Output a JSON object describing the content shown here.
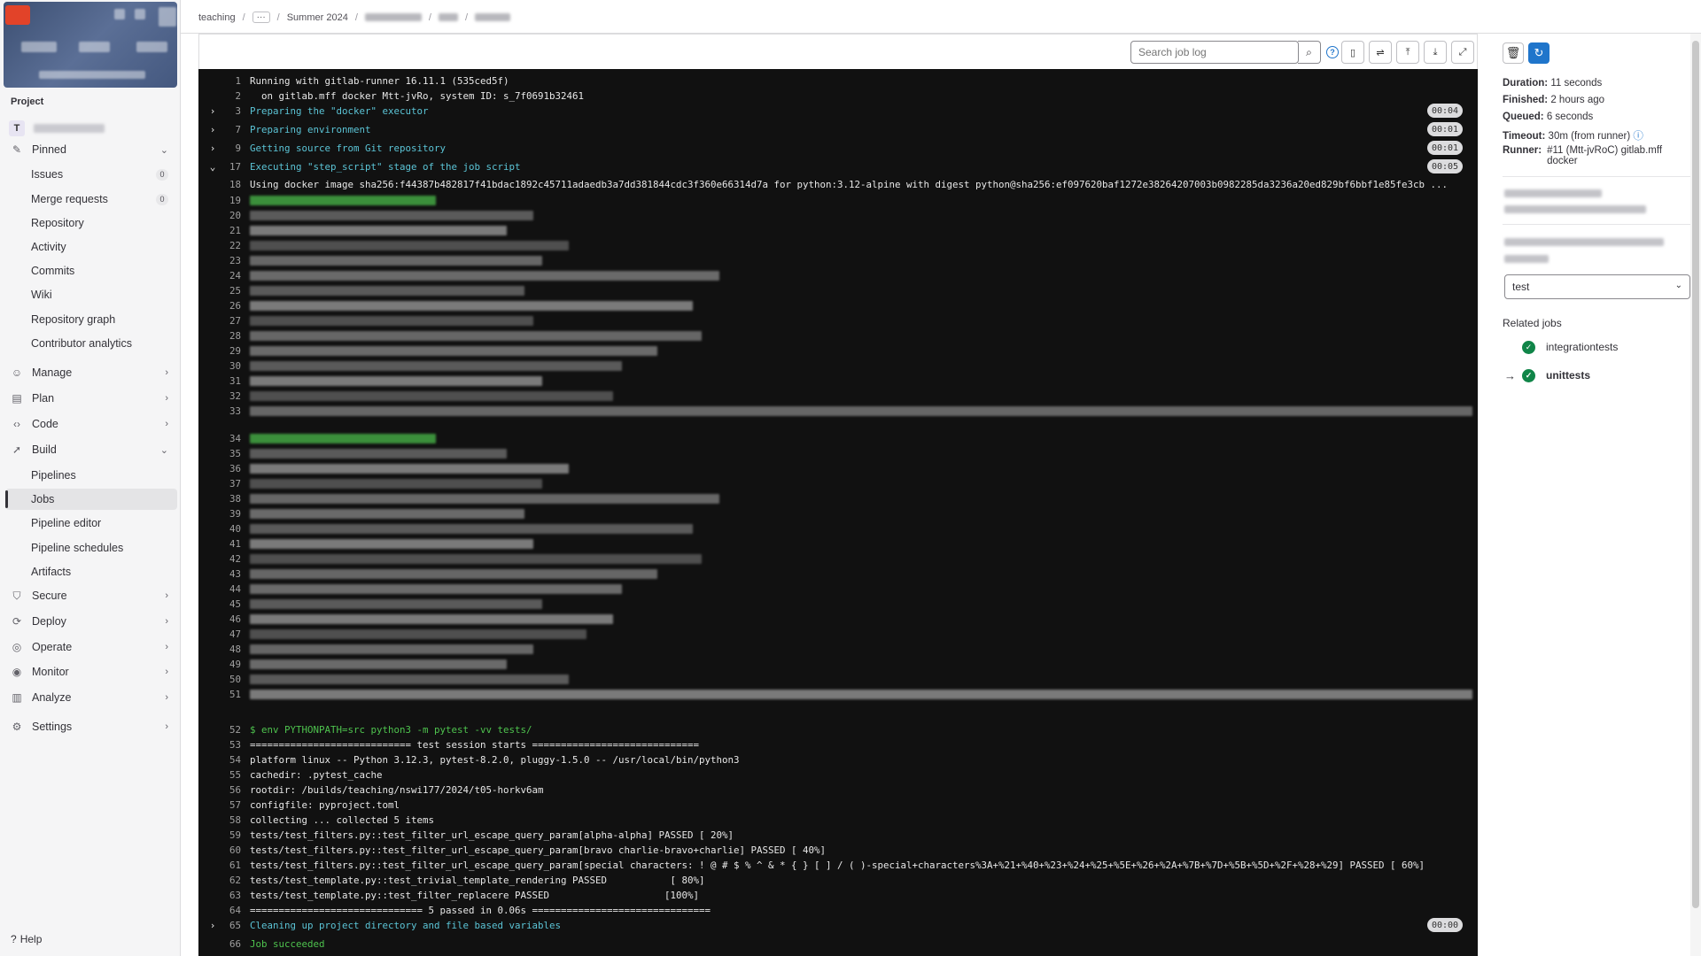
{
  "sidebar": {
    "section_label": "Project",
    "project_avatar_letter": "T",
    "items": [
      {
        "label": "Pinned",
        "icon": "pin-icon",
        "chevron": "˅"
      },
      {
        "label": "Issues",
        "count": "0"
      },
      {
        "label": "Merge requests",
        "count": "0"
      },
      {
        "label": "Repository"
      },
      {
        "label": "Activity"
      },
      {
        "label": "Commits"
      },
      {
        "label": "Wiki"
      },
      {
        "label": "Repository graph"
      },
      {
        "label": "Contributor analytics"
      },
      {
        "label": "Manage",
        "icon": "users-icon"
      },
      {
        "label": "Plan",
        "icon": "plan-icon"
      },
      {
        "label": "Code",
        "icon": "code-icon"
      },
      {
        "label": "Build",
        "icon": "rocket-icon"
      },
      {
        "label": "Pipelines"
      },
      {
        "label": "Jobs"
      },
      {
        "label": "Pipeline editor"
      },
      {
        "label": "Pipeline schedules"
      },
      {
        "label": "Artifacts"
      },
      {
        "label": "Secure",
        "icon": "shield-icon"
      },
      {
        "label": "Deploy",
        "icon": "deploy-icon"
      },
      {
        "label": "Operate",
        "icon": "operate-icon"
      },
      {
        "label": "Monitor",
        "icon": "monitor-icon"
      },
      {
        "label": "Analyze",
        "icon": "chart-icon"
      },
      {
        "label": "Settings",
        "icon": "gear-icon"
      }
    ],
    "help_label": "Help"
  },
  "breadcrumb": {
    "root": "teaching",
    "more": "···",
    "semester": "Summer 2024"
  },
  "log_toolbar": {
    "search_placeholder": "Search job log"
  },
  "log": {
    "lines": [
      {
        "n": "1",
        "text": "Running with gitlab-runner 16.11.1 (535ced5f)"
      },
      {
        "n": "2",
        "text": "  on gitlab.mff docker Mtt-jvRo, system ID: s_7f0691b32461"
      },
      {
        "n": "3",
        "text": "Preparing the \"docker\" executor",
        "time": "00:04"
      },
      {
        "n": "7",
        "text": "Preparing environment",
        "time": "00:01"
      },
      {
        "n": "9",
        "text": "Getting source from Git repository",
        "time": "00:01"
      },
      {
        "n": "17",
        "text": "Executing \"step_script\" stage of the job script",
        "time": "00:05"
      },
      {
        "n": "18",
        "text": "Using docker image sha256:f44387b482817f41bdac1892c45711adaedb3a7dd381844cdc3f360e66314d7a for python:3.12-alpine with digest python@sha256:ef097620baf1272e38264207003b0982285da3236a20ed829bf6bbf1e85fe3cb ..."
      },
      {
        "n": "52",
        "text": "$ env PYTHONPATH=src python3 -m pytest -vv tests/"
      },
      {
        "n": "53",
        "text": "============================ test session starts ============================="
      },
      {
        "n": "54",
        "text": "platform linux -- Python 3.12.3, pytest-8.2.0, pluggy-1.5.0 -- /usr/local/bin/python3"
      },
      {
        "n": "55",
        "text": "cachedir: .pytest_cache"
      },
      {
        "n": "56",
        "text": "rootdir: /builds/teaching/nswi177/2024/t05-horkv6am"
      },
      {
        "n": "57",
        "text": "configfile: pyproject.toml"
      },
      {
        "n": "58",
        "text": "collecting ... collected 5 items"
      },
      {
        "n": "59",
        "text": "tests/test_filters.py::test_filter_url_escape_query_param[alpha-alpha] PASSED [ 20%]"
      },
      {
        "n": "60",
        "text": "tests/test_filters.py::test_filter_url_escape_query_param[bravo charlie-bravo+charlie] PASSED [ 40%]"
      },
      {
        "n": "61",
        "text": "tests/test_filters.py::test_filter_url_escape_query_param[special characters: ! @ # $ % ^ & * { } [ ] / ( )-special+characters%3A+%21+%40+%23+%24+%25+%5E+%26+%2A+%7B+%7D+%5B+%5D+%2F+%28+%29] PASSED [ 60%]"
      },
      {
        "n": "62",
        "text": "tests/test_template.py::test_trivial_template_rendering PASSED           [ 80%]"
      },
      {
        "n": "63",
        "text": "tests/test_template.py::test_filter_replacere PASSED                    [100%]"
      },
      {
        "n": "64",
        "text": "============================== 5 passed in 0.06s ==============================="
      },
      {
        "n": "65",
        "text": "Cleaning up project directory and file based variables",
        "time": "00:00"
      },
      {
        "n": "66",
        "text": "Job succeeded"
      }
    ],
    "hidden_line_numbers": [
      "19",
      "20",
      "21",
      "22",
      "23",
      "24",
      "25",
      "26",
      "27",
      "28",
      "29",
      "30",
      "31",
      "32",
      "33",
      "34",
      "35",
      "36",
      "37",
      "38",
      "39",
      "40",
      "41",
      "42",
      "43",
      "44",
      "45",
      "46",
      "47",
      "48",
      "49",
      "50",
      "51"
    ]
  },
  "job_info": {
    "duration_label": "Duration:",
    "duration": "11 seconds",
    "finished_label": "Finished:",
    "finished": "2 hours ago",
    "queued_label": "Queued:",
    "queued": "6 seconds",
    "timeout_label": "Timeout:",
    "timeout": "30m (from runner)",
    "runner_label": "Runner:",
    "runner": "#11 (Mtt-jvRoC) gitlab.mff docker"
  },
  "stage_select": {
    "value": "test"
  },
  "related_jobs": {
    "title": "Related jobs",
    "jobs": [
      {
        "name": "integrationtests",
        "status": "passed",
        "current": false
      },
      {
        "name": "unittests",
        "status": "passed",
        "current": true
      }
    ],
    "current_marker": "→"
  },
  "colors": {
    "log_bg": "#111111",
    "section_cyan": "#5bc4d6",
    "success_green": "#108548",
    "accent_blue": "#1f75cb"
  }
}
